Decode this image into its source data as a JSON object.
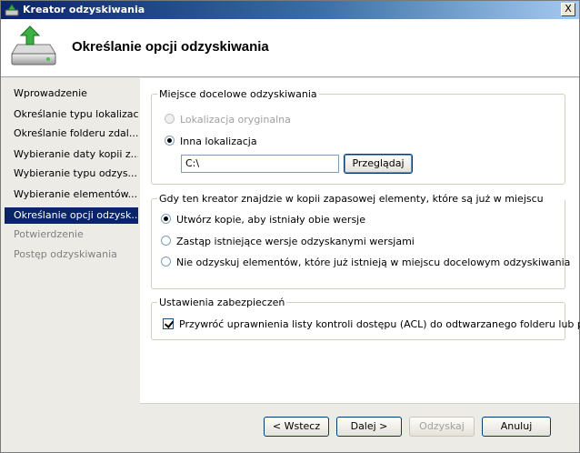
{
  "window": {
    "title": "Kreator odzyskiwania",
    "close_glyph": "X",
    "icon": "wizard-backup-icon"
  },
  "header": {
    "title": "Określanie opcji odzyskiwania",
    "icon": "restore-drive-icon"
  },
  "sidebar": {
    "items": [
      {
        "label": "Wprowadzenie",
        "state": "normal"
      },
      {
        "label": "Określanie typu lokalizacji",
        "state": "normal"
      },
      {
        "label": "Określanie folderu zdal...",
        "state": "normal"
      },
      {
        "label": "Wybieranie daty kopii z...",
        "state": "normal"
      },
      {
        "label": "Wybieranie typu odzys...",
        "state": "normal"
      },
      {
        "label": "Wybieranie elementów...",
        "state": "normal"
      },
      {
        "label": "Określanie opcji odzysk...",
        "state": "active"
      },
      {
        "label": "Potwierdzenie",
        "state": "disabled"
      },
      {
        "label": "Postęp odzyskiwania",
        "state": "disabled"
      }
    ]
  },
  "destination": {
    "legend": "Miejsce docelowe odzyskiwania",
    "original_label": "Lokalizacja oryginalna",
    "other_label": "Inna lokalizacja",
    "selected": "other",
    "path_value": "C:\\",
    "browse_label": "Przeglądaj"
  },
  "conflict": {
    "legend": "Gdy ten kreator znajdzie w kopii zapasowej elementy, które są już w miejscu docelowym",
    "options": [
      {
        "label": "Utwórz kopie, aby istniały obie wersje",
        "checked": true
      },
      {
        "label": "Zastąp istniejące wersje odzyskanymi wersjami",
        "checked": false
      },
      {
        "label": "Nie odzyskuj elementów, które już istnieją w miejscu docelowym odzyskiwania",
        "checked": false
      }
    ]
  },
  "security": {
    "legend": "Ustawienia zabezpieczeń",
    "acl_label": "Przywróć uprawnienia listy kontroli dostępu (ACL) do odtwarzanego folderu lub pliku",
    "acl_checked": true
  },
  "footer": {
    "back_label": "< Wstecz",
    "next_label": "Dalej >",
    "recover_label": "Odzyskaj",
    "cancel_label": "Anuluj"
  }
}
